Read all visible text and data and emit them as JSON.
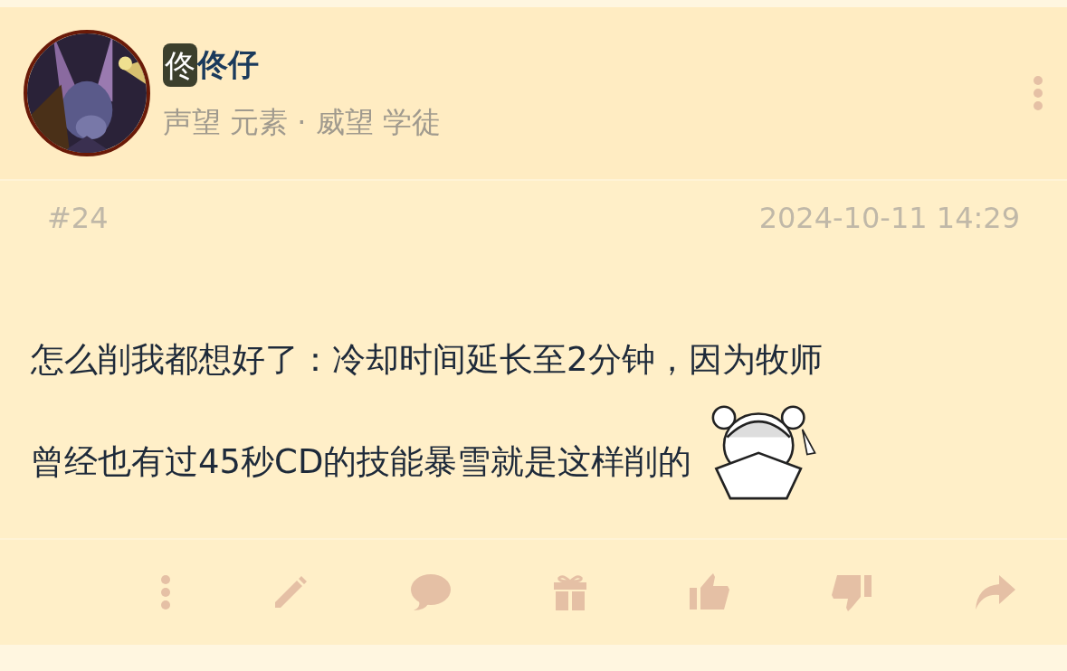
{
  "author": {
    "badge": "佟",
    "name": "佟仔",
    "meta": "声望 元素 · 威望 学徒"
  },
  "post": {
    "floor": "#24",
    "time": "2024-10-11 14:29",
    "lines": [
      "怎么削我都想好了：冷却时间延长至2分钟，因为牧师",
      "曾经也有过45秒CD的技能暴雪就是这样削的"
    ]
  },
  "actions": [
    {
      "kind": "more"
    },
    {
      "kind": "edit"
    },
    {
      "kind": "comment"
    },
    {
      "kind": "gift"
    },
    {
      "kind": "like"
    },
    {
      "kind": "dislike"
    },
    {
      "kind": "share"
    }
  ]
}
